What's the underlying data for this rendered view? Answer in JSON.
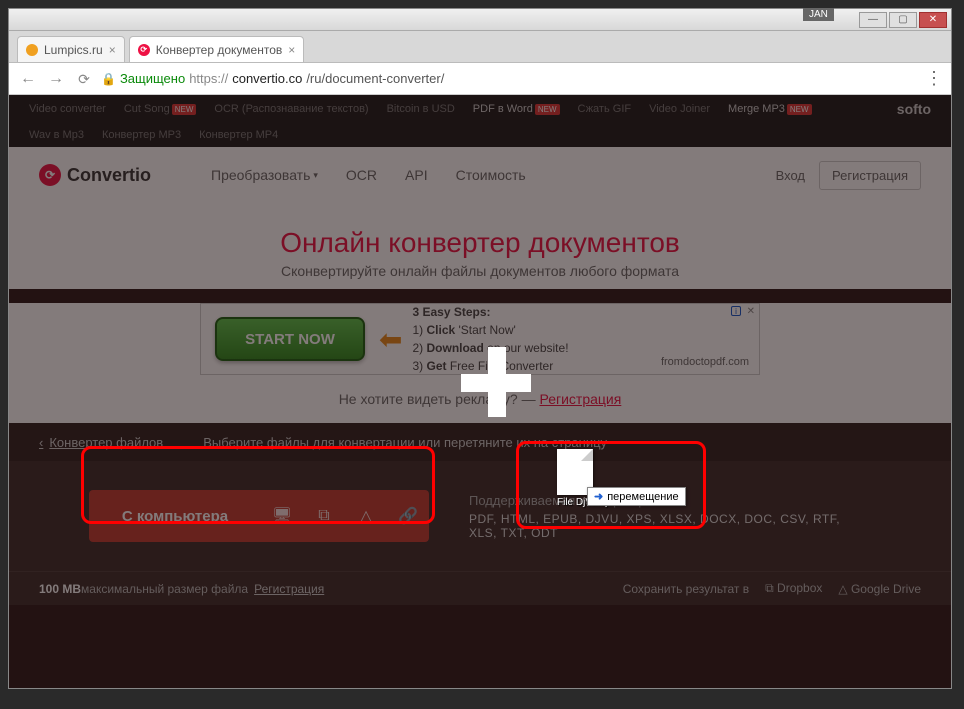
{
  "window": {
    "jan": "JAN"
  },
  "tabs": [
    {
      "title": "Lumpics.ru"
    },
    {
      "title": "Конвертер документов"
    }
  ],
  "address": {
    "secure": "Защищено",
    "scheme": "https://",
    "host": "convertio.co",
    "path": "/ru/document-converter/"
  },
  "softo": {
    "row1": [
      "Video converter",
      "Cut Song",
      "OCR (Распознавание текстов)",
      "Bitcoin в USD",
      "PDF в Word",
      "Сжать GIF",
      "Video Joiner",
      "Merge MP3"
    ],
    "row2": [
      "Wav в Mp3",
      "Конвертер MP3",
      "Конвертер MP4"
    ],
    "brand": "softo",
    "new": "NEW"
  },
  "site": {
    "logo": "Convertio",
    "nav": {
      "convert": "Преобразовать",
      "ocr": "OCR",
      "api": "API",
      "price": "Стоимость"
    },
    "login": "Вход",
    "register": "Регистрация"
  },
  "hero": {
    "title": "Онлайн конвертер документов",
    "subtitle": "Сконвертируйте онлайн файлы документов любого формата"
  },
  "ad": {
    "btn": "START NOW",
    "step_title": "3 Easy Steps:",
    "s1a": "1) ",
    "s1b": "Click",
    "s1c": " 'Start Now'",
    "s2a": "2) ",
    "s2b": "Download",
    "s2c": " on our website!",
    "s3a": "3) ",
    "s3b": "Get",
    "s3c": " Free File Converter",
    "domain": "fromdoctopdf.com"
  },
  "noreg": {
    "text": "Не хотите видеть рекламу? — ",
    "link": "Регистрация"
  },
  "panel": {
    "back": "Конвертер файлов",
    "hint": "Выберите файлы для конвертации или перетяните их на страницу",
    "upload": "С компьютера",
    "fmt_title": "Поддерживаемая конвертация",
    "fmt_list": "PDF, HTML, EPUB, DJVU, XPS, XLSX, DOCX, DOC, CSV, RTF, XLS, TXT, ODT",
    "maxsize": "100 MB",
    "maxlabel": " максимальный размер файла",
    "reg": "Регистрация",
    "saveto": "Сохранить результат в",
    "dropbox": "Dropbox",
    "gdrive": "Google Drive"
  },
  "drag": {
    "filename": "File DjVu.djvu",
    "tip": "перемещение"
  }
}
